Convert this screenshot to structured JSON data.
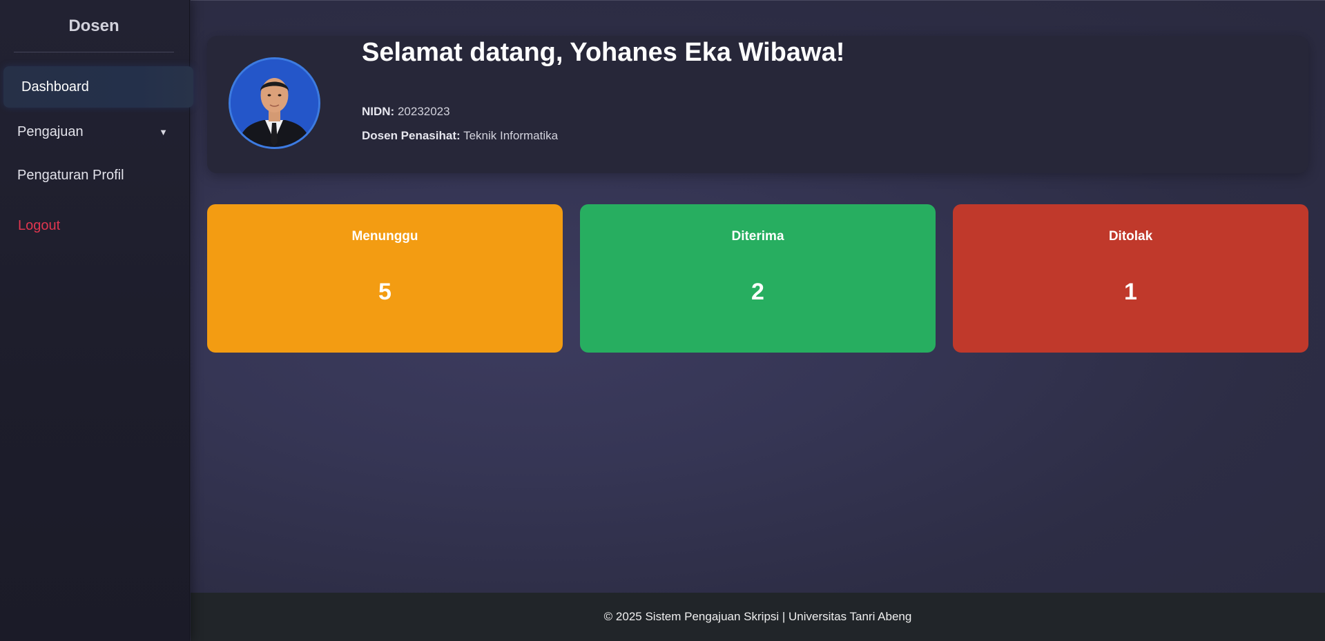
{
  "sidebar": {
    "title": "Dosen",
    "items": [
      {
        "label": "Dashboard",
        "active": true
      },
      {
        "label": "Pengajuan",
        "caret": "▼"
      },
      {
        "label": "Pengaturan Profil"
      },
      {
        "label": "Logout"
      }
    ]
  },
  "welcome": {
    "title": "Selamat datang, Yohanes Eka Wibawa!",
    "nidn_label": "NIDN:",
    "nidn_value": "20232023",
    "advisor_label": "Dosen Penasihat:",
    "advisor_value": "Teknik Informatika"
  },
  "stats": [
    {
      "label": "Menunggu",
      "value": "5",
      "color": "#f39c12"
    },
    {
      "label": "Diterima",
      "value": "2",
      "color": "#27ae60"
    },
    {
      "label": "Ditolak",
      "value": "1",
      "color": "#c0392b"
    }
  ],
  "footer": {
    "text": "© 2025 Sistem Pengajuan Skripsi | Universitas Tanri Abeng"
  },
  "colors": {
    "logout": "#e0364f",
    "avatar_border": "#3d7be0"
  }
}
